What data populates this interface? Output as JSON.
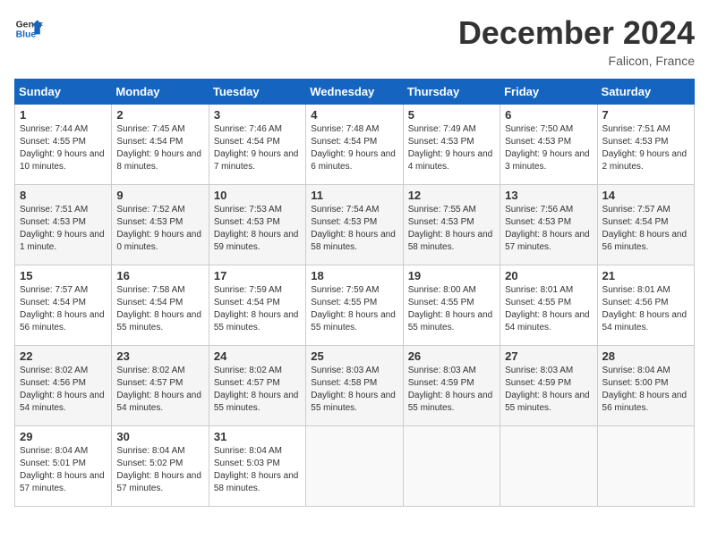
{
  "logo": {
    "general": "General",
    "blue": "Blue"
  },
  "header": {
    "month": "December 2024",
    "location": "Falicon, France"
  },
  "weekdays": [
    "Sunday",
    "Monday",
    "Tuesday",
    "Wednesday",
    "Thursday",
    "Friday",
    "Saturday"
  ],
  "weeks": [
    [
      {
        "day": 1,
        "sunrise": "7:44 AM",
        "sunset": "4:55 PM",
        "daylight": "9 hours and 10 minutes."
      },
      {
        "day": 2,
        "sunrise": "7:45 AM",
        "sunset": "4:54 PM",
        "daylight": "9 hours and 8 minutes."
      },
      {
        "day": 3,
        "sunrise": "7:46 AM",
        "sunset": "4:54 PM",
        "daylight": "9 hours and 7 minutes."
      },
      {
        "day": 4,
        "sunrise": "7:48 AM",
        "sunset": "4:54 PM",
        "daylight": "9 hours and 6 minutes."
      },
      {
        "day": 5,
        "sunrise": "7:49 AM",
        "sunset": "4:53 PM",
        "daylight": "9 hours and 4 minutes."
      },
      {
        "day": 6,
        "sunrise": "7:50 AM",
        "sunset": "4:53 PM",
        "daylight": "9 hours and 3 minutes."
      },
      {
        "day": 7,
        "sunrise": "7:51 AM",
        "sunset": "4:53 PM",
        "daylight": "9 hours and 2 minutes."
      }
    ],
    [
      {
        "day": 8,
        "sunrise": "7:51 AM",
        "sunset": "4:53 PM",
        "daylight": "9 hours and 1 minute."
      },
      {
        "day": 9,
        "sunrise": "7:52 AM",
        "sunset": "4:53 PM",
        "daylight": "9 hours and 0 minutes."
      },
      {
        "day": 10,
        "sunrise": "7:53 AM",
        "sunset": "4:53 PM",
        "daylight": "8 hours and 59 minutes."
      },
      {
        "day": 11,
        "sunrise": "7:54 AM",
        "sunset": "4:53 PM",
        "daylight": "8 hours and 58 minutes."
      },
      {
        "day": 12,
        "sunrise": "7:55 AM",
        "sunset": "4:53 PM",
        "daylight": "8 hours and 58 minutes."
      },
      {
        "day": 13,
        "sunrise": "7:56 AM",
        "sunset": "4:53 PM",
        "daylight": "8 hours and 57 minutes."
      },
      {
        "day": 14,
        "sunrise": "7:57 AM",
        "sunset": "4:54 PM",
        "daylight": "8 hours and 56 minutes."
      }
    ],
    [
      {
        "day": 15,
        "sunrise": "7:57 AM",
        "sunset": "4:54 PM",
        "daylight": "8 hours and 56 minutes."
      },
      {
        "day": 16,
        "sunrise": "7:58 AM",
        "sunset": "4:54 PM",
        "daylight": "8 hours and 55 minutes."
      },
      {
        "day": 17,
        "sunrise": "7:59 AM",
        "sunset": "4:54 PM",
        "daylight": "8 hours and 55 minutes."
      },
      {
        "day": 18,
        "sunrise": "7:59 AM",
        "sunset": "4:55 PM",
        "daylight": "8 hours and 55 minutes."
      },
      {
        "day": 19,
        "sunrise": "8:00 AM",
        "sunset": "4:55 PM",
        "daylight": "8 hours and 55 minutes."
      },
      {
        "day": 20,
        "sunrise": "8:01 AM",
        "sunset": "4:55 PM",
        "daylight": "8 hours and 54 minutes."
      },
      {
        "day": 21,
        "sunrise": "8:01 AM",
        "sunset": "4:56 PM",
        "daylight": "8 hours and 54 minutes."
      }
    ],
    [
      {
        "day": 22,
        "sunrise": "8:02 AM",
        "sunset": "4:56 PM",
        "daylight": "8 hours and 54 minutes."
      },
      {
        "day": 23,
        "sunrise": "8:02 AM",
        "sunset": "4:57 PM",
        "daylight": "8 hours and 54 minutes."
      },
      {
        "day": 24,
        "sunrise": "8:02 AM",
        "sunset": "4:57 PM",
        "daylight": "8 hours and 55 minutes."
      },
      {
        "day": 25,
        "sunrise": "8:03 AM",
        "sunset": "4:58 PM",
        "daylight": "8 hours and 55 minutes."
      },
      {
        "day": 26,
        "sunrise": "8:03 AM",
        "sunset": "4:59 PM",
        "daylight": "8 hours and 55 minutes."
      },
      {
        "day": 27,
        "sunrise": "8:03 AM",
        "sunset": "4:59 PM",
        "daylight": "8 hours and 55 minutes."
      },
      {
        "day": 28,
        "sunrise": "8:04 AM",
        "sunset": "5:00 PM",
        "daylight": "8 hours and 56 minutes."
      }
    ],
    [
      {
        "day": 29,
        "sunrise": "8:04 AM",
        "sunset": "5:01 PM",
        "daylight": "8 hours and 57 minutes."
      },
      {
        "day": 30,
        "sunrise": "8:04 AM",
        "sunset": "5:02 PM",
        "daylight": "8 hours and 57 minutes."
      },
      {
        "day": 31,
        "sunrise": "8:04 AM",
        "sunset": "5:03 PM",
        "daylight": "8 hours and 58 minutes."
      },
      null,
      null,
      null,
      null
    ]
  ],
  "labels": {
    "sunrise": "Sunrise:",
    "sunset": "Sunset:",
    "daylight": "Daylight:"
  }
}
